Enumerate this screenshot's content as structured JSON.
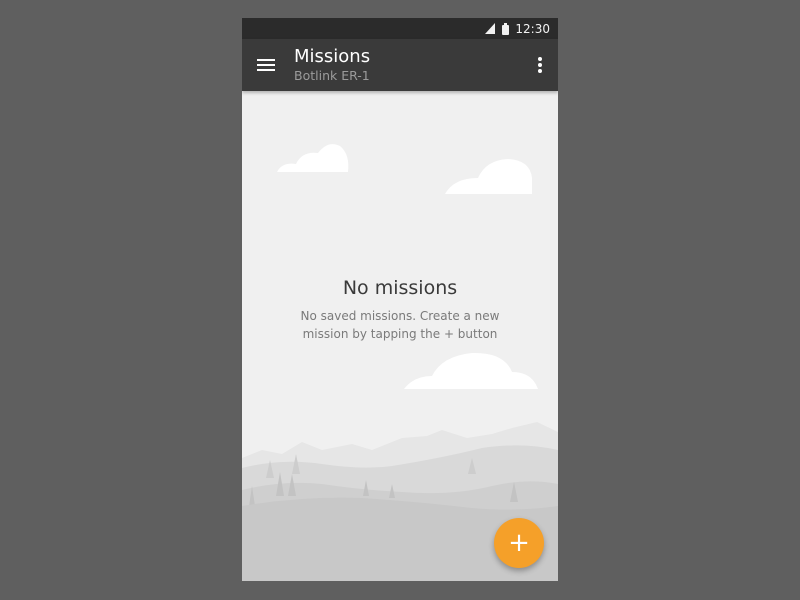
{
  "status_bar": {
    "time": "12:30",
    "icons": [
      "signal-icon",
      "battery-icon"
    ]
  },
  "toolbar": {
    "title": "Missions",
    "subtitle": "Botlink ER-1",
    "icons": [
      "menu-icon",
      "more-vert-icon"
    ]
  },
  "empty_state": {
    "title": "No missions",
    "message": "No saved missions. Create a new mission by tapping the + button"
  },
  "fab": {
    "label": "+",
    "icon": "add-icon",
    "color": "#f5a029"
  },
  "colors": {
    "background": "#5f5f5f",
    "status_bar": "#2b2b2b",
    "toolbar": "#3a3a3a",
    "content": "#f0f0f0",
    "accent": "#f5a029"
  }
}
